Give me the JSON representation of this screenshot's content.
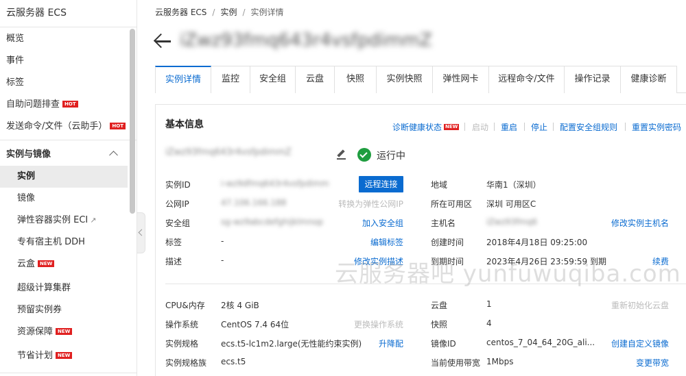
{
  "sidebar": {
    "title": "云服务器 ECS",
    "items": [
      {
        "label": "概览"
      },
      {
        "label": "事件"
      },
      {
        "label": "标签"
      },
      {
        "label": "自助问题排查",
        "badge": "HOT"
      },
      {
        "label": "发送命令/文件（云助手）",
        "badge": "HOT"
      }
    ],
    "section": "实例与镜像",
    "sub_items": [
      {
        "label": "实例",
        "active": true
      },
      {
        "label": "镜像"
      },
      {
        "label": "弹性容器实例 ECI"
      },
      {
        "label": "专有宿主机 DDH"
      },
      {
        "label": "云盒",
        "badge": "NEW"
      },
      {
        "label": "超级计算集群"
      },
      {
        "label": "预留实例券"
      },
      {
        "label": "资源保障",
        "badge": "NEW"
      },
      {
        "label": "节省计划",
        "badge": "NEW"
      }
    ]
  },
  "breadcrumb": [
    "云服务器 ECS",
    "实例",
    "实例详情"
  ],
  "instance_title": "iZwz93fmq643r4vsfpdimmZ",
  "tabs": [
    "实例详情",
    "监控",
    "安全组",
    "云盘",
    "快照",
    "实例快照",
    "弹性网卡",
    "远程命令/文件",
    "操作记录",
    "健康诊断"
  ],
  "basic_info": {
    "title": "基本信息",
    "actions": {
      "diagnose": "诊断健康状态",
      "diagnose_badge": "NEW",
      "start": "启动",
      "restart": "重启",
      "stop": "停止",
      "sg_rules": "配置安全组规则",
      "reset_pwd": "重置实例密码"
    },
    "instance_name": "iZwz93fmq643r4vsfpdimmZ",
    "status": "运行中",
    "rows_left": [
      {
        "label": "实例ID",
        "value": "i-wz9dfmq643r4vsfpdimm",
        "action": "远程连接"
      },
      {
        "label": "公网IP",
        "value": "47.106.166.188",
        "action": "转换为弹性公网IP"
      },
      {
        "label": "安全组",
        "value": "sg-wz9abcdefghijklmnop",
        "action": "加入安全组"
      },
      {
        "label": "标签",
        "value": "-",
        "action": "编辑标签"
      },
      {
        "label": "描述",
        "value": "-",
        "action": "修改实例描述"
      }
    ],
    "rows_right": [
      {
        "label": "地域",
        "value": "华南1（深圳）",
        "action": ""
      },
      {
        "label": "所在可用区",
        "value": "深圳 可用区C",
        "action": ""
      },
      {
        "label": "主机名",
        "value": "iZwz93fmq6",
        "action": "修改实例主机名"
      },
      {
        "label": "创建时间",
        "value": "2018年4月18日 09:25:00",
        "action": ""
      },
      {
        "label": "到期时间",
        "value": "2023年4月26日 23:59:59 到期",
        "action": "续费"
      }
    ],
    "spec_left": [
      {
        "label": "CPU&内存",
        "value": "2核 4 GiB",
        "action": ""
      },
      {
        "label": "操作系统",
        "value": "CentOS 7.4 64位",
        "action": "更换操作系统"
      },
      {
        "label": "实例规格",
        "value": "ecs.t5-lc1m2.large(无性能约束实例)",
        "action": "升降配"
      },
      {
        "label": "实例规格族",
        "value": "ecs.t5",
        "action": ""
      }
    ],
    "spec_right": [
      {
        "label": "云盘",
        "value": "1",
        "action": "重新初始化云盘"
      },
      {
        "label": "快照",
        "value": "4",
        "action": ""
      },
      {
        "label": "镜像ID",
        "value": "centos_7_04_64_20G_ali...",
        "action": "创建自定义镜像"
      },
      {
        "label": "当前使用带宽",
        "value": "1Mbps",
        "action": "变更带宽"
      }
    ]
  },
  "watermark": "云服务器吧 yunfuwuqiba.com",
  "colors": {
    "accent": "#0a6bd0",
    "running": "#1f9d3f",
    "hot": "#e02020"
  }
}
